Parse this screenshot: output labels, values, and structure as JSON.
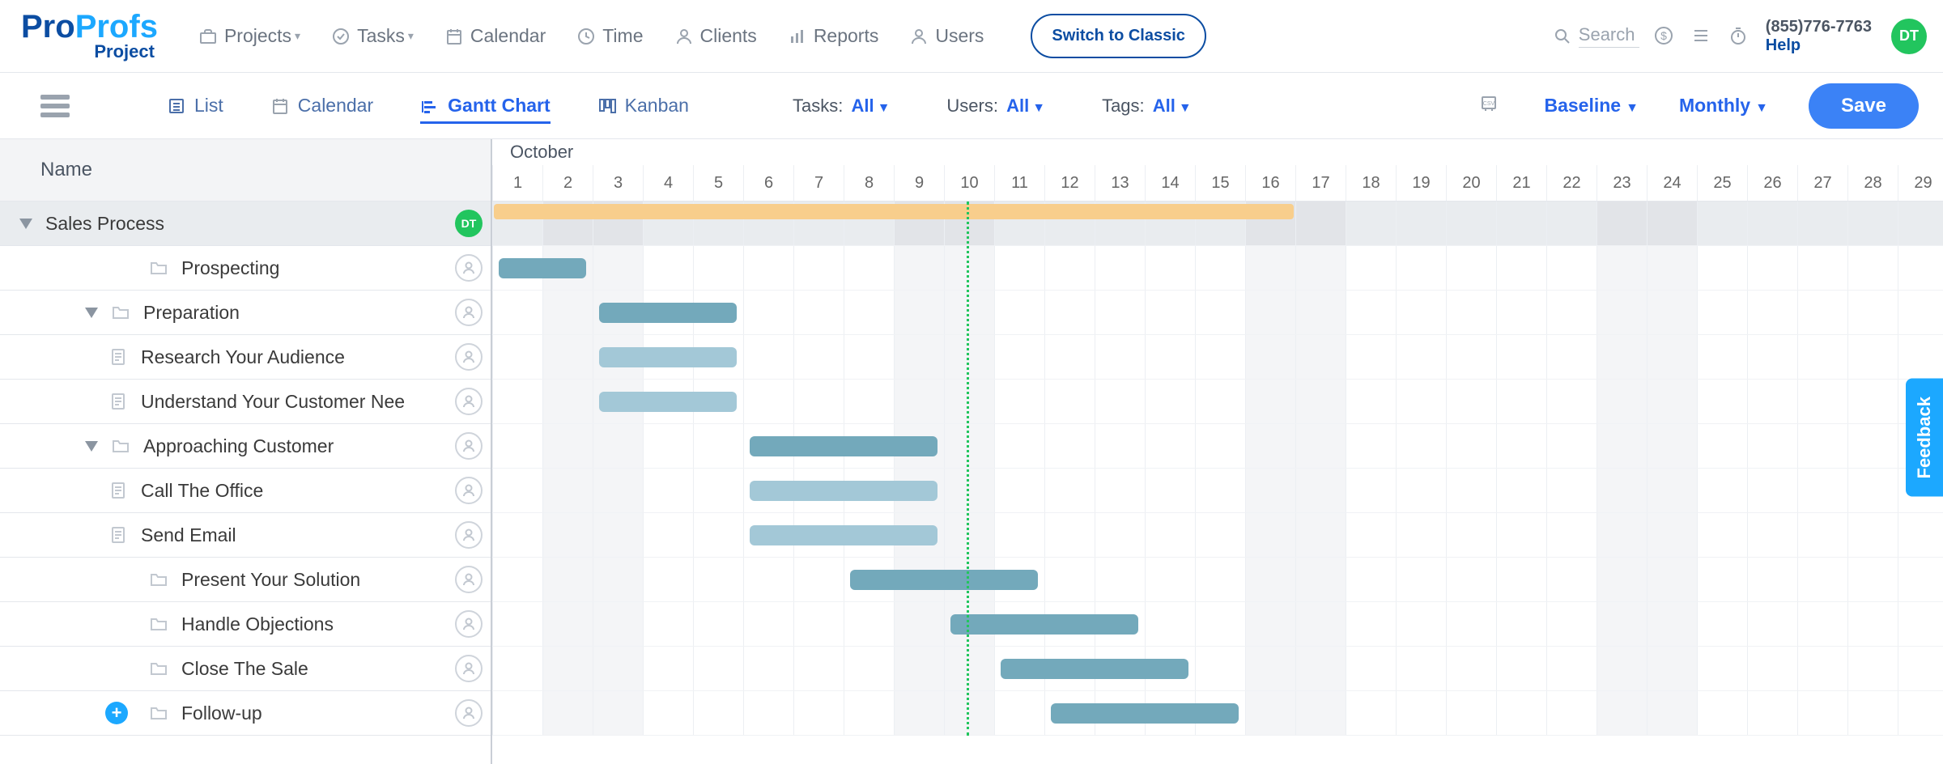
{
  "logo": {
    "pro": "Pro",
    "profs": "Profs",
    "sub": "Project"
  },
  "nav": {
    "projects": "Projects",
    "tasks": "Tasks",
    "calendar": "Calendar",
    "time": "Time",
    "clients": "Clients",
    "reports": "Reports",
    "users": "Users",
    "switch": "Switch to Classic"
  },
  "top_right": {
    "search": "Search",
    "phone": "(855)776-7763",
    "help": "Help",
    "avatar": "DT"
  },
  "subnav": {
    "list": "List",
    "calendar": "Calendar",
    "gantt": "Gantt Chart",
    "kanban": "Kanban",
    "tasks_lbl": "Tasks:",
    "tasks_val": "All",
    "users_lbl": "Users:",
    "users_val": "All",
    "tags_lbl": "Tags:",
    "tags_val": "All",
    "baseline": "Baseline",
    "monthly": "Monthly",
    "save": "Save"
  },
  "left_header": "Name",
  "month": "October",
  "days": [
    1,
    2,
    3,
    4,
    5,
    6,
    7,
    8,
    9,
    10,
    11,
    12,
    13,
    14,
    15,
    16,
    17,
    18,
    19,
    20,
    21,
    22,
    23,
    24,
    25,
    26,
    27,
    28,
    29
  ],
  "weekends": [
    2,
    3,
    9,
    10,
    16,
    17,
    23,
    24
  ],
  "today": 10,
  "rows": [
    {
      "level": 0,
      "name": "Sales Process",
      "avatar": "DT",
      "tri": true,
      "icon": "none"
    },
    {
      "level": 1,
      "name": "Prospecting",
      "icon": "folder"
    },
    {
      "level": 2,
      "name": "Preparation",
      "tri": true,
      "icon": "folder"
    },
    {
      "level": 3,
      "name": "Research Your Audience",
      "icon": "doc"
    },
    {
      "level": 3,
      "name": "Understand Your Customer Nee",
      "icon": "doc"
    },
    {
      "level": 2,
      "name": "Approaching Customer",
      "tri": true,
      "icon": "folder"
    },
    {
      "level": 3,
      "name": "Call The Office",
      "icon": "doc"
    },
    {
      "level": 3,
      "name": "Send Email",
      "icon": "doc"
    },
    {
      "level": 1,
      "name": "Present Your Solution",
      "icon": "folder"
    },
    {
      "level": 1,
      "name": "Handle Objections",
      "icon": "folder"
    },
    {
      "level": 1,
      "name": "Close The Sale",
      "icon": "folder"
    },
    {
      "level": 1,
      "name": "Follow-up",
      "icon": "folder",
      "add": true
    }
  ],
  "chart_data": {
    "type": "gantt",
    "bars": [
      {
        "row": 0,
        "start": 1,
        "end": 17,
        "kind": "project"
      },
      {
        "row": 1,
        "start": 1,
        "end": 3,
        "kind": "parent"
      },
      {
        "row": 2,
        "start": 3,
        "end": 6,
        "kind": "parent"
      },
      {
        "row": 3,
        "start": 3,
        "end": 6,
        "kind": "task"
      },
      {
        "row": 4,
        "start": 3,
        "end": 6,
        "kind": "task"
      },
      {
        "row": 5,
        "start": 6,
        "end": 10,
        "kind": "parent"
      },
      {
        "row": 6,
        "start": 6,
        "end": 10,
        "kind": "task"
      },
      {
        "row": 7,
        "start": 6,
        "end": 10,
        "kind": "task"
      },
      {
        "row": 8,
        "start": 8,
        "end": 12,
        "kind": "parent"
      },
      {
        "row": 9,
        "start": 10,
        "end": 14,
        "kind": "parent"
      },
      {
        "row": 10,
        "start": 11,
        "end": 15,
        "kind": "parent"
      },
      {
        "row": 11,
        "start": 12,
        "end": 16,
        "kind": "parent"
      }
    ]
  },
  "feedback": "Feedback"
}
